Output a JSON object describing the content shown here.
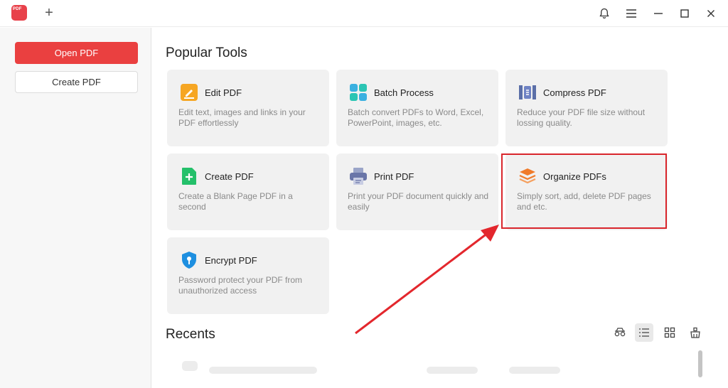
{
  "titlebar": {
    "logo_text": "PDF",
    "new_tab_symbol": "+"
  },
  "sidebar": {
    "open_pdf_label": "Open PDF",
    "create_pdf_label": "Create PDF"
  },
  "main": {
    "popular_tools_title": "Popular Tools",
    "recents_title": "Recents",
    "tools": [
      {
        "title": "Edit PDF",
        "desc": "Edit text, images and links in your PDF effortlessly",
        "icon": "edit-icon"
      },
      {
        "title": "Batch Process",
        "desc": "Batch convert PDFs to Word, Excel, PowerPoint, images, etc.",
        "icon": "batch-icon"
      },
      {
        "title": "Compress PDF",
        "desc": "Reduce your PDF file size without lossing quality.",
        "icon": "compress-icon"
      },
      {
        "title": "Create PDF",
        "desc": "Create a Blank Page PDF in a second",
        "icon": "create-icon"
      },
      {
        "title": "Print PDF",
        "desc": "Print your PDF document quickly and easily",
        "icon": "print-icon"
      },
      {
        "title": "Organize PDFs",
        "desc": "Simply sort, add, delete PDF pages and etc.",
        "icon": "organize-icon"
      },
      {
        "title": "Encrypt PDF",
        "desc": "Password protect your PDF from unauthorized access",
        "icon": "shield-icon"
      }
    ]
  },
  "colors": {
    "accent": "#ea4040",
    "highlight": "#d9262c",
    "card_bg": "#f1f1f1"
  }
}
